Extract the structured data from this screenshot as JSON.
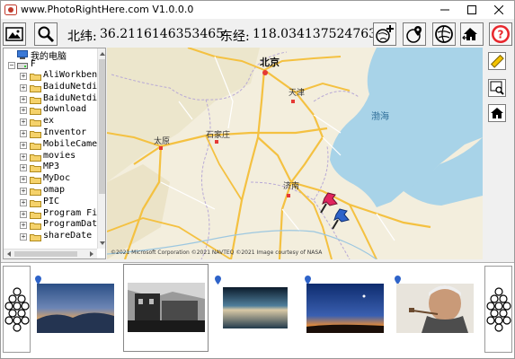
{
  "window": {
    "title": "www.PhotoRightHere.com V1.0.0.0"
  },
  "coords": {
    "lat_label": "北纬:",
    "lat": "36.2116146353465",
    "lon_label": "东经:",
    "lon": "118.034137524763"
  },
  "tree": {
    "root": "我的电脑",
    "drive": "F",
    "items": [
      {
        "label": "AliWorkbenc"
      },
      {
        "label": "BaiduNetdi"
      },
      {
        "label": "BaiduNetdi"
      },
      {
        "label": "download"
      },
      {
        "label": "ex"
      },
      {
        "label": "Inventor"
      },
      {
        "label": "MobileCamer"
      },
      {
        "label": "movies"
      },
      {
        "label": "MP3"
      },
      {
        "label": "MyDoc"
      },
      {
        "label": "omap"
      },
      {
        "label": "PIC"
      },
      {
        "label": "Program Fil"
      },
      {
        "label": "ProgramData"
      },
      {
        "label": "shareDate"
      }
    ]
  },
  "map": {
    "cities": {
      "beijing": "北京",
      "tianjin": "天津",
      "taiyuan": "太原",
      "shijiazhuang": "石家庄",
      "jinan": "济南",
      "bohai": "渤海"
    },
    "copyright": "©2021 Microsoft Corporation ©2021 NAVTEQ ©2021 Image courtesy of NASA",
    "colors": {
      "land": "#f3eedd",
      "sea": "#a8d3e8",
      "highway": "#f4c141",
      "pin": "#e0245e",
      "pin2": "#2e63c9"
    }
  },
  "thumbnails": [
    {
      "name": "sunset-clouds"
    },
    {
      "name": "bw-building"
    },
    {
      "name": "long-exposure-water"
    },
    {
      "name": "twilight-moon"
    },
    {
      "name": "old-man-pipe"
    }
  ]
}
